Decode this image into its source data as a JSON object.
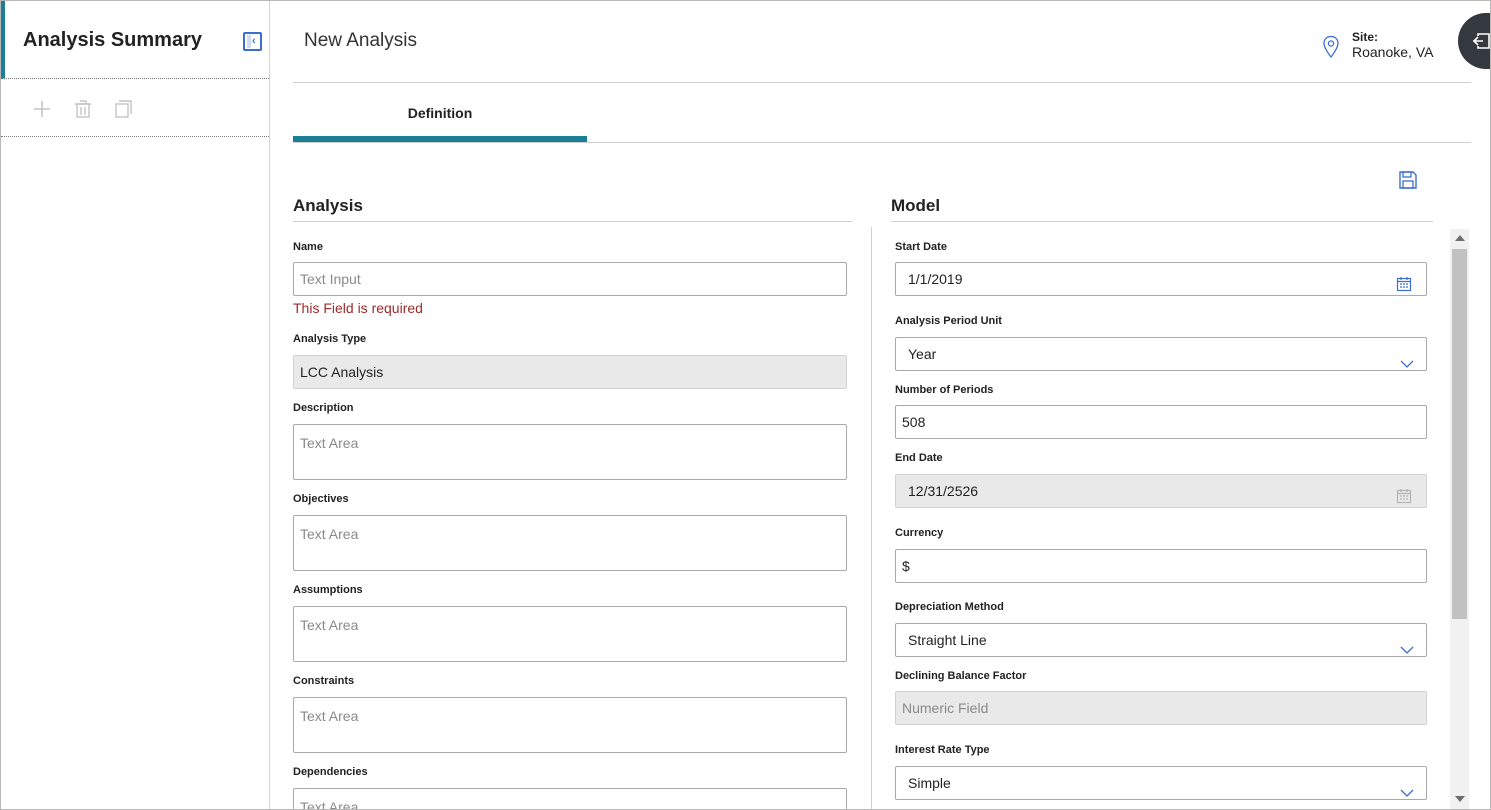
{
  "left_panel": {
    "title": "Analysis Summary",
    "collapse_icon": "collapse-panel-icon",
    "tools": [
      "plus-icon",
      "trash-icon",
      "copy-icon"
    ]
  },
  "header": {
    "title": "New Analysis",
    "site_label": "Site:",
    "site_value": "Roanoke, VA",
    "site_icon": "location-pin-icon",
    "exit_icon": "sign-out-icon"
  },
  "tabs": [
    {
      "label": "Definition",
      "active": true
    }
  ],
  "colors": {
    "accent": "#1d7f96",
    "error": "#9e2a2b",
    "icon_blue": "#3c6ed0"
  },
  "analysis": {
    "title": "Analysis",
    "name_label": "Name",
    "name_placeholder": "Text Input",
    "name_error": "This Field is required",
    "type_label": "Analysis Type",
    "type_value": "LCC Analysis",
    "description_label": "Description",
    "description_placeholder": "Text Area",
    "objectives_label": "Objectives",
    "objectives_placeholder": "Text Area",
    "assumptions_label": "Assumptions",
    "assumptions_placeholder": "Text Area",
    "constraints_label": "Constraints",
    "constraints_placeholder": "Text Area",
    "dependencies_label": "Dependencies",
    "dependencies_placeholder": "Text Area"
  },
  "model": {
    "title": "Model",
    "start_date_label": "Start Date",
    "start_date_value": "1/1/2019",
    "period_unit_label": "Analysis Period Unit",
    "period_unit_value": "Year",
    "num_periods_label": "Number of Periods",
    "num_periods_value": "508",
    "end_date_label": "End Date",
    "end_date_value": "12/31/2526",
    "currency_label": "Currency",
    "currency_value": "$",
    "depreciation_label": "Depreciation Method",
    "depreciation_value": "Straight Line",
    "dbf_label": "Declining Balance Factor",
    "dbf_placeholder": "Numeric Field",
    "interest_label": "Interest Rate Type",
    "interest_value": "Simple"
  }
}
